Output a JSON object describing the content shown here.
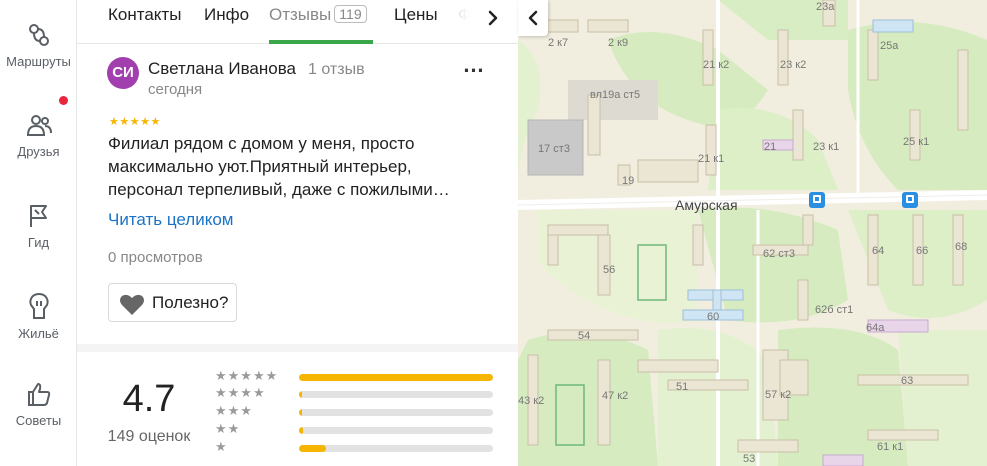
{
  "rail": {
    "items": [
      {
        "label": "Маршруты",
        "icon": "routes-icon"
      },
      {
        "label": "Друзья",
        "icon": "friends-icon"
      },
      {
        "label": "Гид",
        "icon": "guide-flag-icon"
      },
      {
        "label": "Жильё",
        "icon": "housing-icon"
      },
      {
        "label": "Советы",
        "icon": "thumbs-up-icon"
      }
    ]
  },
  "tabs": {
    "items": [
      "Контакты",
      "Инфо",
      "Отзывы",
      "Цены",
      "Ф"
    ],
    "active": "Отзывы",
    "reviews_count": "119"
  },
  "review": {
    "avatar_initials": "СИ",
    "author": "Светлана Иванова",
    "author_reviews": "1 отзыв",
    "date": "сегодня",
    "stars": "★★★★★",
    "text": "Филиал рядом с домом у меня, просто максимально уют.Приятный интерьер, персонал терпеливый, даже с пожилыми…",
    "read_more": "Читать целиком",
    "views": "0 просмотров",
    "useful_label": "Полезно?"
  },
  "ratings": {
    "value": "4.7",
    "count_label": "149 оценок",
    "distribution": [
      {
        "stars": "★★★★★",
        "fraction": 1.0
      },
      {
        "stars": "★★★★",
        "fraction": 0.015
      },
      {
        "stars": "★★★",
        "fraction": 0.01
      },
      {
        "stars": "★★",
        "fraction": 0.02
      },
      {
        "stars": "★",
        "fraction": 0.14
      }
    ]
  },
  "map": {
    "street": "Амурская",
    "labels": [
      "23а",
      "2 к7",
      "2 к9",
      "25а",
      "21 к2",
      "23 к2",
      "вл19а ст5",
      "21",
      "23 к1",
      "25 к1",
      "17 ст3",
      "21 к1",
      "19",
      "62 ст3",
      "64",
      "66",
      "68",
      "56",
      "60",
      "62б ст1",
      "64а",
      "54",
      "51",
      "57 к2",
      "63",
      "43 к2",
      "47 к2",
      "61 к1",
      "53"
    ]
  },
  "colors": {
    "accent_green": "#3aa84a",
    "link_blue": "#1a73c7",
    "star_yellow": "#f5b500",
    "avatar_purple": "#a23fae",
    "notification_red": "#e8253a"
  }
}
